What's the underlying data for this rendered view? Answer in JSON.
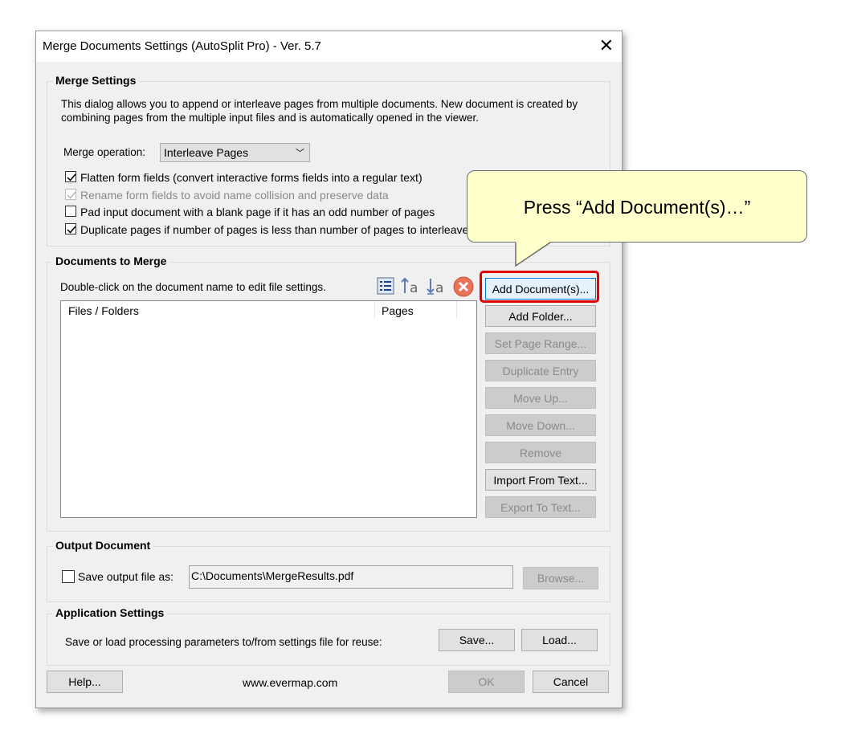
{
  "dialog": {
    "title": "Merge Documents Settings (AutoSplit Pro) - Ver. 5.7",
    "close_label": "✕"
  },
  "merge_settings": {
    "title": "Merge Settings",
    "description_line1": "This dialog allows you to append or interleave pages from multiple documents. New document is created by",
    "description_line2": "combining pages from the multiple input files and is automatically opened in the viewer.",
    "operation_label": "Merge operation:",
    "operation_value": "Interleave Pages",
    "options": [
      {
        "label": "Flatten form fields (convert interactive forms fields into a regular text)",
        "checked": true,
        "enabled": true
      },
      {
        "label": "Rename form fields to avoid name collision and preserve data",
        "checked": true,
        "enabled": false
      },
      {
        "label": "Pad input document with a blank page if it has an odd number of pages",
        "checked": false,
        "enabled": true
      },
      {
        "label": "Duplicate pages if number of pages is less than number of pages to interleave",
        "checked": true,
        "enabled": true
      }
    ]
  },
  "documents": {
    "title": "Documents to Merge",
    "hint": "Double-click on the document name to edit file settings.",
    "col_files": "Files / Folders",
    "col_pages": "Pages",
    "buttons": {
      "add_documents": "Add Document(s)...",
      "add_folder": "Add Folder...",
      "set_page_range": "Set Page Range...",
      "duplicate_entry": "Duplicate Entry",
      "move_up": "Move Up...",
      "move_down": "Move Down...",
      "remove": "Remove",
      "import_from_text": "Import From Text...",
      "export_to_text": "Export To Text..."
    },
    "toolbar_icons": [
      "list-icon",
      "sort-ascending-icon",
      "sort-descending-icon",
      "clear-icon"
    ]
  },
  "output": {
    "title": "Output Document",
    "save_label": "Save output file as:",
    "save_checked": false,
    "path": "C:\\Documents\\MergeResults.pdf",
    "browse": "Browse..."
  },
  "app_settings": {
    "title": "Application Settings",
    "description": "Save or load processing parameters to/from settings file for reuse:",
    "save": "Save...",
    "load": "Load..."
  },
  "footer": {
    "help": "Help...",
    "website": "www.evermap.com",
    "ok": "OK",
    "cancel": "Cancel"
  },
  "callout": {
    "text": "Press “Add Document(s)…”"
  },
  "colors": {
    "highlight": "#e00000",
    "callout_bg": "#ffffcc",
    "focus_border": "#0078d7"
  }
}
